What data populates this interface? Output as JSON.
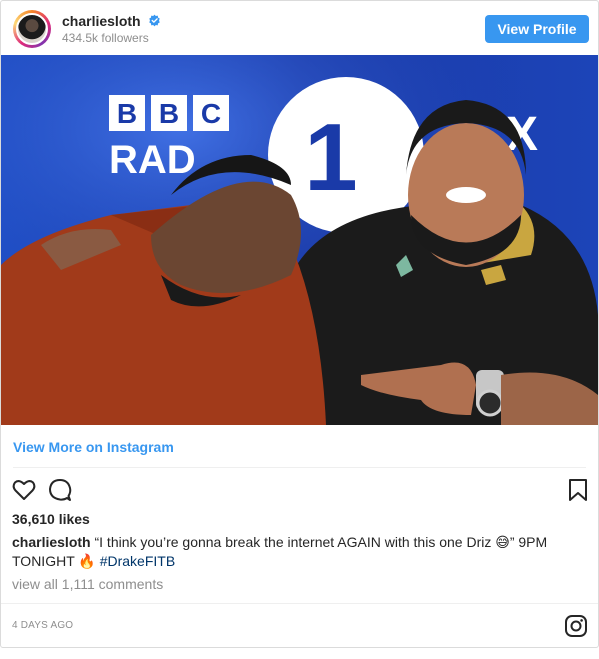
{
  "header": {
    "username": "charliesloth",
    "verified_badge": "verified-checkmark",
    "followers": "434.5k followers",
    "view_profile_label": "View Profile"
  },
  "photo": {
    "background_logo_text_line1": "BBC",
    "background_logo_text_line2": "RADIO",
    "station_mark": "1X"
  },
  "links": {
    "view_more": "View More on Instagram"
  },
  "actions": {
    "like_icon": "heart-icon",
    "comment_icon": "comment-icon",
    "save_icon": "bookmark-icon"
  },
  "post": {
    "likes": "36,610 likes",
    "caption_user": "charliesloth",
    "caption_text": " “I think you’re gonna break the internet AGAIN with this one Driz 😅” 9PM TONIGHT 🔥 ",
    "hashtag": "#DrakeFITB",
    "view_all_comments": "view all 1,111 comments",
    "timestamp": "4 DAYS AGO"
  },
  "footer": {
    "logo_icon": "instagram-icon"
  },
  "colors": {
    "accent": "#3897f0",
    "hashtag": "#003569",
    "muted": "#8e8e8e",
    "text": "#262626",
    "border": "#dbdbdb"
  }
}
